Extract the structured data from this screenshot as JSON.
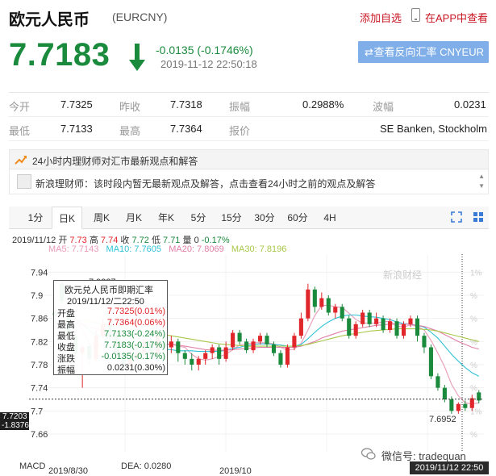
{
  "header": {
    "title": "欧元人民币",
    "code": "(EURCNY)",
    "add_watch": "添加自选",
    "app_view": "在APP中查看"
  },
  "quote": {
    "price": "7.7183",
    "change": "-0.0135 (-0.1746%)",
    "time": "2019-11-12 22:50:18",
    "reverse_button": "查看反向汇率 CNYEUR",
    "direction": "down",
    "color_down": "#1a8a3c",
    "color_up": "#e0262a"
  },
  "stats": {
    "row1": [
      {
        "label": "今开",
        "value": "7.7325"
      },
      {
        "label": "昨收",
        "value": "7.7318"
      },
      {
        "label": "振幅",
        "value": "0.2988%"
      },
      {
        "label": "波幅",
        "value": "0.0231"
      }
    ],
    "row2": [
      {
        "label": "最低",
        "value": "7.7133"
      },
      {
        "label": "最高",
        "value": "7.7364"
      },
      {
        "label": "报价",
        "value": "SE Banken, Stockholm"
      }
    ]
  },
  "opinion": {
    "title": "24小时内理财师对汇市最新观点和解答",
    "text": "新浪理财师：该时段内暂无最新观点及解答，点击查看24小时之前的观点及解答"
  },
  "tabs": [
    {
      "label": "1分",
      "active": false
    },
    {
      "label": "日K",
      "active": true
    },
    {
      "label": "周K",
      "active": false
    },
    {
      "label": "月K",
      "active": false
    },
    {
      "label": "年K",
      "active": false
    },
    {
      "label": "5分",
      "active": false
    },
    {
      "label": "15分",
      "active": false
    },
    {
      "label": "30分",
      "active": false
    },
    {
      "label": "60分",
      "active": false
    },
    {
      "label": "4H",
      "active": false
    }
  ],
  "bar_info": {
    "date": "2019/11/12",
    "open_label": "开",
    "open": "7.73",
    "high_label": "高",
    "high": "7.74",
    "low_label": "收",
    "close": "7.72",
    "close_label": "低",
    "low": "7.71",
    "vol_label": "量",
    "vol": "0",
    "pct": "-0.17%"
  },
  "ma_info": [
    {
      "text": "MA5: 7.7143",
      "color": "#e99ab8"
    },
    {
      "text": "MA10: 7.7605",
      "color": "#2ec2d6"
    },
    {
      "text": "MA20: 7.8069",
      "color": "#e07fa6"
    },
    {
      "text": "MA30: 7.8196",
      "color": "#a8c84a"
    }
  ],
  "tooltip": {
    "title": "欧元兑人民币即期汇率",
    "date": "2019/11/12/二22:50",
    "rows": [
      {
        "label": "开盘",
        "value": "7.7325(0.01%)",
        "color": "#e0262a"
      },
      {
        "label": "最高",
        "value": "7.7364(0.06%)",
        "color": "#e0262a"
      },
      {
        "label": "最低",
        "value": "7.7133(-0.24%)",
        "color": "#1a8a3c"
      },
      {
        "label": "收盘",
        "value": "7.7183(-0.17%)",
        "color": "#1a8a3c"
      },
      {
        "label": "涨跌",
        "value": "-0.0135(-0.17%)",
        "color": "#1a8a3c"
      },
      {
        "label": "振幅",
        "value": "0.0231(0.30%)",
        "color": "#222"
      }
    ]
  },
  "chart_data": {
    "type": "candlestick",
    "y_ticks": [
      "7.94",
      "7.9",
      "7.86",
      "7.82",
      "7.78",
      "7.74",
      "7.7",
      "7.66"
    ],
    "ylim": [
      7.66,
      7.96
    ],
    "high_label": "7.9237",
    "low_label": "7.6952",
    "current_label": "7.7203",
    "current_pct": "-1.8376%",
    "right_pct_ticks": [
      "1%",
      "%",
      "%",
      "%",
      "%",
      "%",
      "1%",
      "%"
    ],
    "x_labels": [
      "2019/8/30",
      "2019/10"
    ],
    "bottom_labels": [
      "MACD",
      "DEA: 0.0280"
    ],
    "watermark": "新浪财经",
    "candles": [
      {
        "o": 7.87,
        "c": 7.865,
        "h": 7.88,
        "l": 7.85
      },
      {
        "o": 7.92,
        "c": 7.89,
        "h": 7.925,
        "l": 7.885
      },
      {
        "o": 7.87,
        "c": 7.83,
        "h": 7.88,
        "l": 7.82
      },
      {
        "o": 7.83,
        "c": 7.8,
        "h": 7.84,
        "l": 7.795
      },
      {
        "o": 7.8,
        "c": 7.81,
        "h": 7.815,
        "l": 7.74
      },
      {
        "o": 7.812,
        "c": 7.79,
        "h": 7.818,
        "l": 7.78
      },
      {
        "o": 7.79,
        "c": 7.83,
        "h": 7.84,
        "l": 7.785
      },
      {
        "o": 7.83,
        "c": 7.85,
        "h": 7.86,
        "l": 7.825
      },
      {
        "o": 7.85,
        "c": 7.83,
        "h": 7.855,
        "l": 7.82
      },
      {
        "o": 7.83,
        "c": 7.8,
        "h": 7.835,
        "l": 7.79
      },
      {
        "o": 7.8,
        "c": 7.78,
        "h": 7.81,
        "l": 7.77
      },
      {
        "o": 7.78,
        "c": 7.79,
        "h": 7.8,
        "l": 7.77
      },
      {
        "o": 7.79,
        "c": 7.8,
        "h": 7.81,
        "l": 7.785
      },
      {
        "o": 7.8,
        "c": 7.82,
        "h": 7.825,
        "l": 7.795
      },
      {
        "o": 7.82,
        "c": 7.8,
        "h": 7.83,
        "l": 7.795
      },
      {
        "o": 7.8,
        "c": 7.83,
        "h": 7.84,
        "l": 7.795
      },
      {
        "o": 7.83,
        "c": 7.81,
        "h": 7.845,
        "l": 7.8
      },
      {
        "o": 7.81,
        "c": 7.82,
        "h": 7.83,
        "l": 7.8
      },
      {
        "o": 7.82,
        "c": 7.8,
        "h": 7.825,
        "l": 7.785
      },
      {
        "o": 7.8,
        "c": 7.79,
        "h": 7.805,
        "l": 7.78
      },
      {
        "o": 7.79,
        "c": 7.78,
        "h": 7.8,
        "l": 7.77
      },
      {
        "o": 7.78,
        "c": 7.79,
        "h": 7.795,
        "l": 7.77
      },
      {
        "o": 7.79,
        "c": 7.8,
        "h": 7.805,
        "l": 7.78
      },
      {
        "o": 7.8,
        "c": 7.81,
        "h": 7.815,
        "l": 7.79
      },
      {
        "o": 7.81,
        "c": 7.79,
        "h": 7.815,
        "l": 7.78
      },
      {
        "o": 7.79,
        "c": 7.81,
        "h": 7.82,
        "l": 7.785
      },
      {
        "o": 7.81,
        "c": 7.835,
        "h": 7.84,
        "l": 7.805
      },
      {
        "o": 7.835,
        "c": 7.82,
        "h": 7.84,
        "l": 7.815
      },
      {
        "o": 7.82,
        "c": 7.805,
        "h": 7.825,
        "l": 7.8
      },
      {
        "o": 7.805,
        "c": 7.82,
        "h": 7.825,
        "l": 7.8
      },
      {
        "o": 7.82,
        "c": 7.83,
        "h": 7.835,
        "l": 7.815
      },
      {
        "o": 7.83,
        "c": 7.815,
        "h": 7.835,
        "l": 7.81
      },
      {
        "o": 7.815,
        "c": 7.8,
        "h": 7.82,
        "l": 7.795
      },
      {
        "o": 7.8,
        "c": 7.78,
        "h": 7.805,
        "l": 7.775
      },
      {
        "o": 7.78,
        "c": 7.81,
        "h": 7.815,
        "l": 7.775
      },
      {
        "o": 7.81,
        "c": 7.83,
        "h": 7.835,
        "l": 7.805
      },
      {
        "o": 7.83,
        "c": 7.86,
        "h": 7.87,
        "l": 7.825
      },
      {
        "o": 7.86,
        "c": 7.91,
        "h": 7.92,
        "l": 7.855
      },
      {
        "o": 7.91,
        "c": 7.88,
        "h": 7.915,
        "l": 7.87
      },
      {
        "o": 7.88,
        "c": 7.895,
        "h": 7.905,
        "l": 7.875
      },
      {
        "o": 7.895,
        "c": 7.87,
        "h": 7.9,
        "l": 7.865
      },
      {
        "o": 7.87,
        "c": 7.88,
        "h": 7.885,
        "l": 7.86
      },
      {
        "o": 7.88,
        "c": 7.86,
        "h": 7.885,
        "l": 7.855
      },
      {
        "o": 7.86,
        "c": 7.83,
        "h": 7.865,
        "l": 7.825
      },
      {
        "o": 7.83,
        "c": 7.85,
        "h": 7.855,
        "l": 7.825
      },
      {
        "o": 7.85,
        "c": 7.87,
        "h": 7.875,
        "l": 7.845
      },
      {
        "o": 7.87,
        "c": 7.85,
        "h": 7.875,
        "l": 7.845
      },
      {
        "o": 7.85,
        "c": 7.86,
        "h": 7.87,
        "l": 7.845
      },
      {
        "o": 7.86,
        "c": 7.84,
        "h": 7.865,
        "l": 7.835
      },
      {
        "o": 7.84,
        "c": 7.855,
        "h": 7.86,
        "l": 7.835
      },
      {
        "o": 7.855,
        "c": 7.83,
        "h": 7.86,
        "l": 7.825
      },
      {
        "o": 7.83,
        "c": 7.85,
        "h": 7.855,
        "l": 7.825
      },
      {
        "o": 7.85,
        "c": 7.86,
        "h": 7.865,
        "l": 7.845
      },
      {
        "o": 7.86,
        "c": 7.83,
        "h": 7.865,
        "l": 7.82
      },
      {
        "o": 7.83,
        "c": 7.81,
        "h": 7.835,
        "l": 7.8
      },
      {
        "o": 7.81,
        "c": 7.76,
        "h": 7.815,
        "l": 7.755
      },
      {
        "o": 7.76,
        "c": 7.74,
        "h": 7.765,
        "l": 7.735
      },
      {
        "o": 7.74,
        "c": 7.72,
        "h": 7.745,
        "l": 7.715
      },
      {
        "o": 7.72,
        "c": 7.7,
        "h": 7.725,
        "l": 7.695
      },
      {
        "o": 7.7,
        "c": 7.712,
        "h": 7.715,
        "l": 7.695
      },
      {
        "o": 7.712,
        "c": 7.705,
        "h": 7.718,
        "l": 7.7
      },
      {
        "o": 7.705,
        "c": 7.722,
        "h": 7.728,
        "l": 7.7
      },
      {
        "o": 7.732,
        "c": 7.718,
        "h": 7.736,
        "l": 7.713
      }
    ],
    "series": [
      {
        "name": "MA5",
        "color": "#e99ab8",
        "values": [
          7.87,
          7.88,
          7.875,
          7.86,
          7.84,
          7.815,
          7.812,
          7.815,
          7.822,
          7.822,
          7.812,
          7.8,
          7.79,
          7.792,
          7.8,
          7.808,
          7.814,
          7.816,
          7.812,
          7.81,
          7.798,
          7.79,
          7.788,
          7.79,
          7.794,
          7.798,
          7.806,
          7.814,
          7.816,
          7.818,
          7.818,
          7.818,
          7.816,
          7.81,
          7.805,
          7.807,
          7.817,
          7.84,
          7.865,
          7.882,
          7.883,
          7.88,
          7.879,
          7.869,
          7.858,
          7.852,
          7.852,
          7.852,
          7.854,
          7.855,
          7.847,
          7.845,
          7.849,
          7.846,
          7.84,
          7.822,
          7.8,
          7.776,
          7.746,
          7.726,
          7.714,
          7.712,
          7.714
        ]
      },
      {
        "name": "MA10",
        "color": "#2ec2d6",
        "values": [
          7.865,
          7.87,
          7.868,
          7.86,
          7.85,
          7.84,
          7.832,
          7.828,
          7.828,
          7.82,
          7.815,
          7.808,
          7.805,
          7.806,
          7.806,
          7.806,
          7.806,
          7.806,
          7.804,
          7.804,
          7.804,
          7.803,
          7.803,
          7.803,
          7.803,
          7.805,
          7.808,
          7.81,
          7.813,
          7.815,
          7.816,
          7.816,
          7.815,
          7.814,
          7.812,
          7.812,
          7.815,
          7.825,
          7.836,
          7.846,
          7.854,
          7.86,
          7.864,
          7.866,
          7.866,
          7.864,
          7.863,
          7.862,
          7.86,
          7.858,
          7.854,
          7.851,
          7.85,
          7.848,
          7.845,
          7.836,
          7.826,
          7.812,
          7.798,
          7.786,
          7.775,
          7.766,
          7.76
        ]
      },
      {
        "name": "MA20",
        "color": "#e07fa6",
        "values": [
          7.85,
          7.852,
          7.854,
          7.852,
          7.85,
          7.846,
          7.842,
          7.838,
          7.836,
          7.834,
          7.832,
          7.828,
          7.825,
          7.822,
          7.82,
          7.818,
          7.816,
          7.815,
          7.814,
          7.812,
          7.81,
          7.808,
          7.806,
          7.805,
          7.805,
          7.805,
          7.806,
          7.807,
          7.808,
          7.809,
          7.81,
          7.81,
          7.81,
          7.81,
          7.81,
          7.81,
          7.812,
          7.816,
          7.82,
          7.826,
          7.83,
          7.834,
          7.838,
          7.84,
          7.842,
          7.844,
          7.846,
          7.848,
          7.849,
          7.85,
          7.85,
          7.85,
          7.85,
          7.848,
          7.846,
          7.842,
          7.838,
          7.832,
          7.826,
          7.82,
          7.815,
          7.81,
          7.807
        ]
      },
      {
        "name": "MA30",
        "color": "#a8c84a",
        "values": [
          7.855,
          7.856,
          7.857,
          7.857,
          7.856,
          7.854,
          7.852,
          7.85,
          7.848,
          7.846,
          7.844,
          7.842,
          7.84,
          7.838,
          7.836,
          7.834,
          7.832,
          7.83,
          7.828,
          7.826,
          7.824,
          7.822,
          7.82,
          7.818,
          7.816,
          7.815,
          7.814,
          7.813,
          7.812,
          7.812,
          7.812,
          7.812,
          7.812,
          7.812,
          7.812,
          7.812,
          7.813,
          7.815,
          7.818,
          7.821,
          7.824,
          7.827,
          7.83,
          7.832,
          7.834,
          7.836,
          7.838,
          7.839,
          7.84,
          7.841,
          7.842,
          7.842,
          7.842,
          7.842,
          7.841,
          7.84,
          7.838,
          7.835,
          7.832,
          7.829,
          7.826,
          7.823,
          7.82
        ]
      }
    ]
  },
  "watermark_wx": "微信号: tradequan",
  "date_badge": "2019/11/12 22:50"
}
